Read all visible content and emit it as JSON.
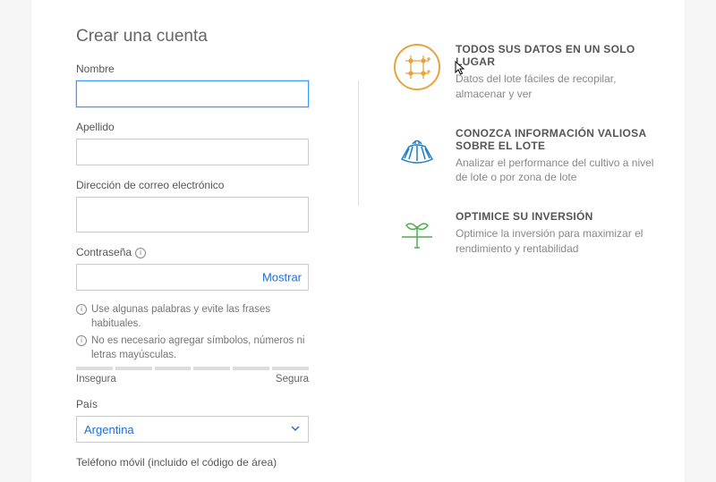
{
  "form": {
    "title": "Crear una cuenta",
    "firstNameLabel": "Nombre",
    "lastNameLabel": "Apellido",
    "emailLabel": "Dirección de correo electrónico",
    "passwordLabel": "Contraseña",
    "showLabel": "Mostrar",
    "hint1": "Use algunas palabras y evite las frases habituales.",
    "hint2": "No es necesario agregar símbolos, números ni letras mayúsculas.",
    "strengthWeak": "Insegura",
    "strengthStrong": "Segura",
    "countryLabel": "País",
    "countryValue": "Argentina",
    "phoneLabel": "Teléfono móvil (incluido el código de área)"
  },
  "features": [
    {
      "title": "TODOS SUS DATOS EN UN SOLO LUGAR",
      "desc": "Datos del lote fáciles de recopilar, almacenar y ver"
    },
    {
      "title": "CONOZCA INFORMACIÓN VALIOSA SOBRE EL LOTE",
      "desc": "Analizar el performance del cultivo a nivel de lote o por zona de lote"
    },
    {
      "title": "OPTIMICE SU INVERSIÓN",
      "desc": "Optimice la inversión para maximizar el rendimiento y rentabilidad"
    }
  ]
}
